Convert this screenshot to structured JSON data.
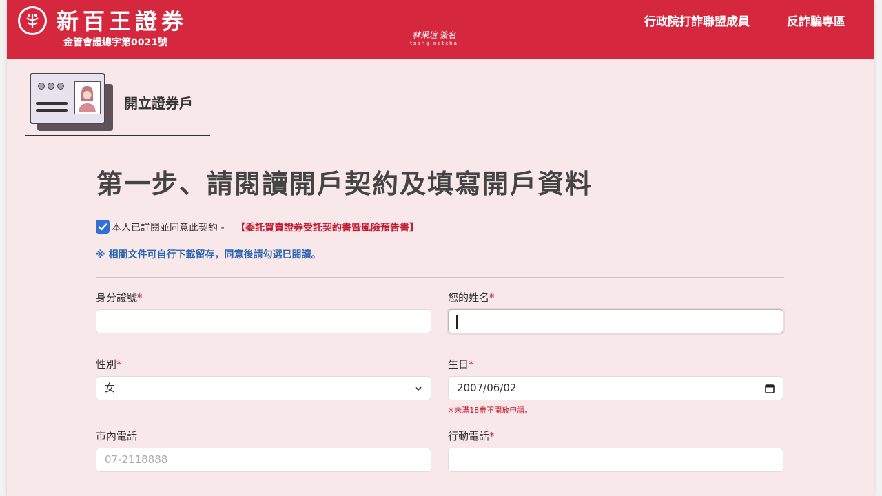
{
  "header": {
    "brand_name": "新百王證券",
    "license": "金管會證總字第0021號",
    "signature": "林采瑄 簽名",
    "signature_sub": "tsang.natcha",
    "nav": [
      "行政院打詐聯盟成員",
      "反詐騙專區"
    ],
    "color": "#d5283f"
  },
  "section": {
    "title": "開立證券戶"
  },
  "main": {
    "step_title": "第一步、請閱讀開戶契約及填寫開戶資料",
    "agree": {
      "checked": true,
      "text": "本人已詳閱並同意此契約 -",
      "link": "【委託買賣證券受託契約書暨風險預告書】"
    },
    "notice": "※ 相關文件可自行下載留存，同意後請勾選已閱讀。",
    "fields": {
      "id_number": {
        "label": "身分證號",
        "required": "*",
        "value": ""
      },
      "name": {
        "label": "您的姓名",
        "required": "*",
        "value": ""
      },
      "gender": {
        "label": "性別",
        "required": "*",
        "value": "女"
      },
      "birthday": {
        "label": "生日",
        "required": "*",
        "value": "2007/06/02",
        "hint": "※未滿18歲不開放申請。"
      },
      "home_phone": {
        "label": "市內電話",
        "placeholder": "07-2118888"
      },
      "mobile_phone": {
        "label": "行動電話",
        "required": "*",
        "value": ""
      }
    }
  }
}
